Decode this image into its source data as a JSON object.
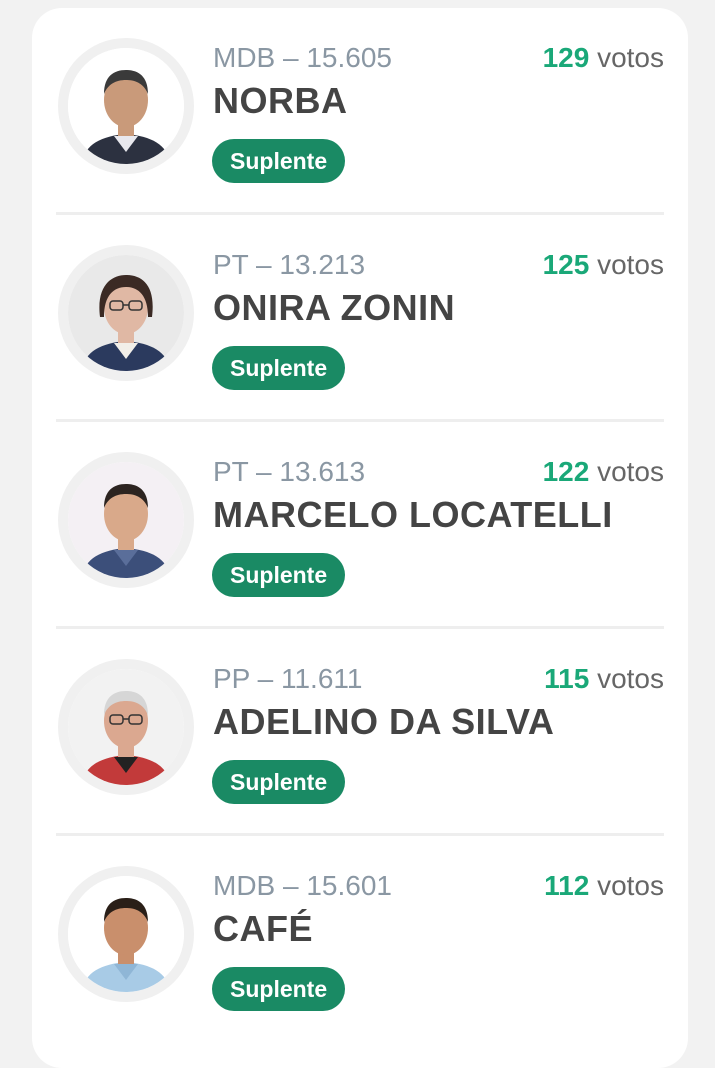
{
  "candidates": [
    {
      "party": "MDB – 15.605",
      "name": "NORBA",
      "votes": "129",
      "votes_unit": "votos",
      "status": "Suplente",
      "photo": {
        "bg": "#ffffff",
        "skin": "#c99a7a",
        "hair": "#3a3a3a",
        "shirt": "#2c3140",
        "collar": "#e8e8ee"
      }
    },
    {
      "party": "PT – 13.213",
      "name": "ONIRA ZONIN",
      "votes": "125",
      "votes_unit": "votos",
      "status": "Suplente",
      "photo": {
        "bg": "#e9e9e9",
        "skin": "#e0b8a4",
        "hair": "#3b2a24",
        "shirt": "#2b3a5e",
        "collar": "#f2efe9"
      }
    },
    {
      "party": "PT – 13.613",
      "name": "MARCELO LOCATELLI",
      "votes": "122",
      "votes_unit": "votos",
      "status": "Suplente",
      "photo": {
        "bg": "#f4f0f4",
        "skin": "#d9a98a",
        "hair": "#2c2420",
        "shirt": "#3c4f7a",
        "collar": "#5a6e9a"
      }
    },
    {
      "party": "PP – 11.611",
      "name": "ADELINO DA SILVA",
      "votes": "115",
      "votes_unit": "votos",
      "status": "Suplente",
      "photo": {
        "bg": "#f2f2f2",
        "skin": "#dba890",
        "hair": "#d6d6d6",
        "shirt": "#c23a3a",
        "collar": "#222222"
      }
    },
    {
      "party": "MDB – 15.601",
      "name": "CAFÉ",
      "votes": "112",
      "votes_unit": "votos",
      "status": "Suplente",
      "photo": {
        "bg": "#ffffff",
        "skin": "#c98f6c",
        "hair": "#2a1f18",
        "shirt": "#a8cbe6",
        "collar": "#8fb6d6"
      }
    }
  ]
}
